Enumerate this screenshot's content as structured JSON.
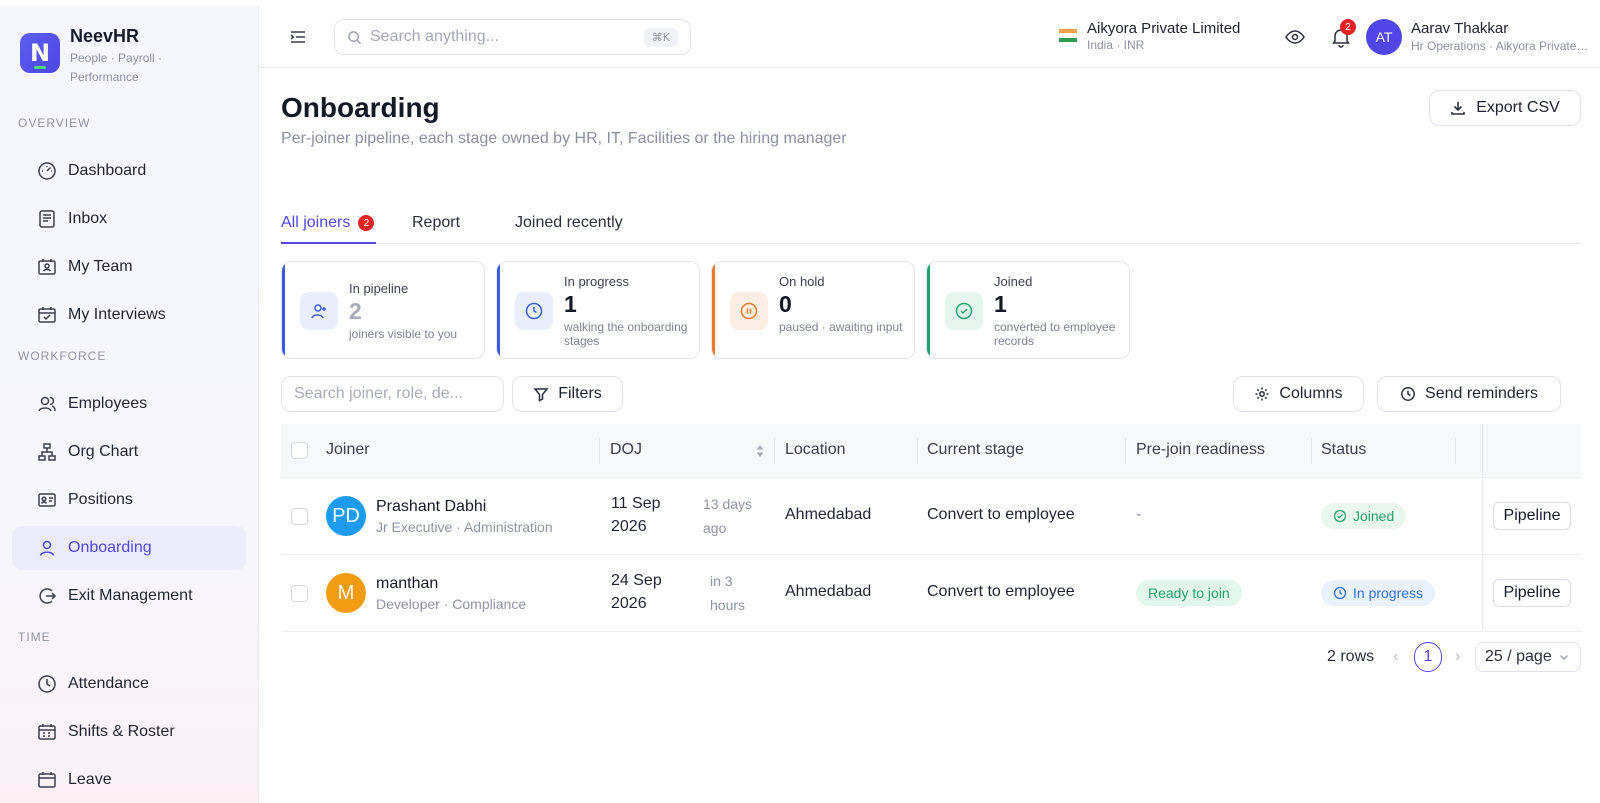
{
  "brand": {
    "name": "NeevHR",
    "tagline": "People · Payroll · Performance"
  },
  "sidebar": {
    "sections": [
      "OVERVIEW",
      "WORKFORCE",
      "TIME"
    ],
    "items": [
      {
        "label": "Dashboard",
        "icon": "gauge-icon"
      },
      {
        "label": "Inbox",
        "icon": "inbox-icon"
      },
      {
        "label": "My Team",
        "icon": "team-icon"
      },
      {
        "label": "My Interviews",
        "icon": "calendar-check-icon"
      },
      {
        "label": "Employees",
        "icon": "users-icon"
      },
      {
        "label": "Org Chart",
        "icon": "org-chart-icon"
      },
      {
        "label": "Positions",
        "icon": "id-card-icon"
      },
      {
        "label": "Onboarding",
        "icon": "user-icon",
        "active": true
      },
      {
        "label": "Exit Management",
        "icon": "exit-icon"
      },
      {
        "label": "Attendance",
        "icon": "clock-icon"
      },
      {
        "label": "Shifts & Roster",
        "icon": "calendar-grid-icon"
      },
      {
        "label": "Leave",
        "icon": "calendar-icon"
      }
    ]
  },
  "topbar": {
    "search_placeholder": "Search anything...",
    "search_shortcut": "⌘K",
    "org_name": "Aikyora Private Limited",
    "org_sub": "India · INR",
    "notification_count": "2",
    "user_initials": "AT",
    "user_name": "Aarav Thakkar",
    "user_sub": "Hr Operations · Aikyora Private Limited"
  },
  "page": {
    "title": "Onboarding",
    "subtitle": "Per-joiner pipeline, each stage owned by HR, IT, Facilities or the hiring manager",
    "export_label": "Export CSV"
  },
  "tabs": [
    {
      "label": "All joiners",
      "badge": "2",
      "active": true
    },
    {
      "label": "Report"
    },
    {
      "label": "Joined recently"
    }
  ],
  "stats": [
    {
      "label": "In pipeline",
      "value": "2",
      "desc": "joiners visible to you",
      "accent": "#3b5bdb"
    },
    {
      "label": "In progress",
      "value": "1",
      "desc": "walking the onboarding stages",
      "accent": "#3b5bdb"
    },
    {
      "label": "On hold",
      "value": "0",
      "desc": "paused · awaiting input",
      "accent": "#ea7a2a"
    },
    {
      "label": "Joined",
      "value": "1",
      "desc": "converted to employee records",
      "accent": "#22a06b"
    }
  ],
  "toolbar": {
    "search_placeholder": "Search joiner, role, de...",
    "filters_label": "Filters",
    "columns_label": "Columns",
    "reminders_label": "Send reminders"
  },
  "table": {
    "columns": [
      "Joiner",
      "DOJ",
      "Location",
      "Current stage",
      "Pre-join readiness",
      "Status"
    ],
    "rows": [
      {
        "initials": "PD",
        "avatar_color": "#1d9bf0",
        "name": "Prashant Dabhi",
        "sub": "Jr Executive · Administration",
        "doj_date": "11 Sep",
        "doj_year": "2026",
        "rel_1": "13 days",
        "rel_2": "ago",
        "location": "Ahmedabad",
        "stage": "Convert to employee",
        "readiness": "-",
        "status": "Joined",
        "action": "Pipeline"
      },
      {
        "initials": "M",
        "avatar_color": "#f39c12",
        "name": "manthan",
        "sub": "Developer · Compliance",
        "doj_date": "24 Sep",
        "doj_year": "2026",
        "rel_1": "in 3",
        "rel_2": "hours",
        "location": "Ahmedabad",
        "stage": "Convert to employee",
        "readiness": "Ready to join",
        "status": "In progress",
        "action": "Pipeline"
      }
    ]
  },
  "pager": {
    "rows_text": "2 rows",
    "current_page": "1",
    "page_size": "25 / page"
  }
}
